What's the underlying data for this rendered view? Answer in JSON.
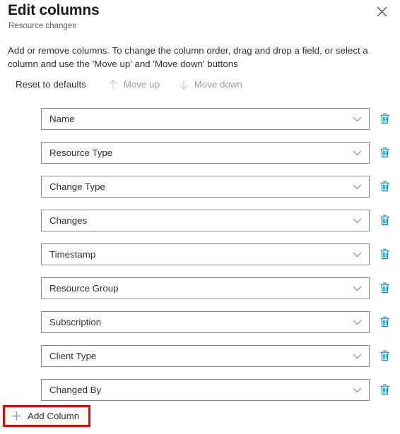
{
  "header": {
    "title": "Edit columns",
    "subtitle": "Resource changes",
    "close_label": "Close"
  },
  "description": "Add or remove columns. To change the column order, drag and drop a field, or select a column and use the 'Move up' and 'Move down' buttons",
  "command_bar": {
    "reset_label": "Reset to defaults",
    "move_up_label": "Move up",
    "move_down_label": "Move down"
  },
  "columns": [
    {
      "label": "Name"
    },
    {
      "label": "Resource Type"
    },
    {
      "label": "Change Type"
    },
    {
      "label": "Changes"
    },
    {
      "label": "Timestamp"
    },
    {
      "label": "Resource Group"
    },
    {
      "label": "Subscription"
    },
    {
      "label": "Client Type"
    },
    {
      "label": "Changed By"
    }
  ],
  "add_column": {
    "label": "Add Column"
  },
  "colors": {
    "accent_blue": "#0078d4",
    "light_blue": "#71afe5",
    "chevron": "#7a8c9e",
    "border": "#8a8886",
    "disabled_text": "#a19f9d",
    "text": "#323130",
    "subtitle": "#605e5c",
    "highlight_red": "#ee0000"
  }
}
